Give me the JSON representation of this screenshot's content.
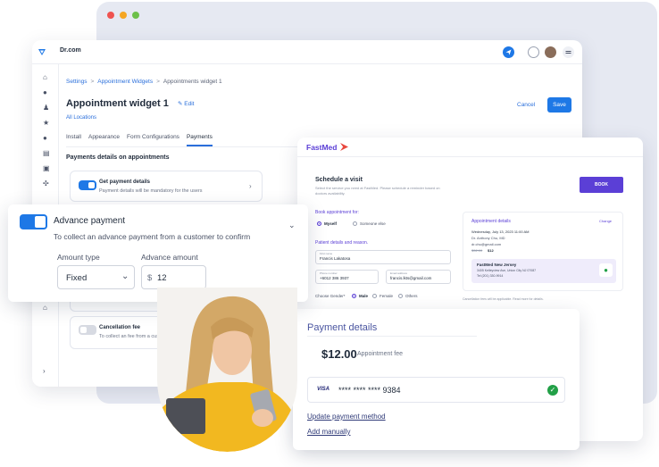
{
  "app": {
    "brand": "Dr.com",
    "breadcrumb": [
      "Settings",
      "Appointment Widgets",
      "Appointments widget 1"
    ],
    "page_title": "Appointment widget 1",
    "edit_label": "Edit",
    "locations_label": "All Locations",
    "cancel_label": "Cancel",
    "save_label": "Save",
    "tabs": [
      {
        "label": "Install"
      },
      {
        "label": "Appearance"
      },
      {
        "label": "Form Configurations"
      },
      {
        "label": "Payments"
      }
    ],
    "section_title": "Payments details on appointments",
    "get_payment": {
      "title": "Get payment details",
      "subtitle": "Payment details will be mandatory for the users"
    },
    "cancellation": {
      "title": "Cancellation fee",
      "subtitle": "To collect an fee from a custome"
    }
  },
  "advance_payment": {
    "title": "Advance payment",
    "subtitle": "To collect an advance payment from a customer to confirm",
    "amount_type_label": "Amount type",
    "amount_type_value": "Fixed",
    "advance_amount_label": "Advance amount",
    "currency_symbol": "$",
    "advance_amount_value": "12"
  },
  "fastmed": {
    "brand": "FastMed",
    "schedule_title": "Schedule a visit",
    "schedule_desc_1": "Select the service you need at FastMed. Please schedule a reminder based on",
    "schedule_desc_2": "doctors availability.",
    "book_label": "BOOK",
    "book_for_label": "Book appointment for:",
    "book_for_options": [
      "Myself",
      "Someone else"
    ],
    "patient_label": "Patient details and reason.",
    "name_field_label": "First name",
    "name_field_value": "Francis Lakatosa",
    "phone_label": "Phone number",
    "phone_value": "+6012 386 3937",
    "email_label": "Email address",
    "email_value": "francis.lkts@gmail.com",
    "gender_label": "Choose Gender*",
    "gender_options": [
      "Male",
      "Female",
      "Others"
    ],
    "appt_title": "Appointment details",
    "change_label": "Change",
    "appt_datetime": "Wednesday, July 13, 2023 11:00 AM",
    "doctor": "Dr. Anthony Chu, MD",
    "doctor_email": "dr.chu@gmail.com",
    "old_price": "$32.00",
    "new_price": "$12",
    "location_name": "FastMed New Jersey",
    "location_addr": "3405 Kelleyview Ave, Union City NJ 07087",
    "location_phone": "Tel (201) 330-9914",
    "disclaimer": "Cancellation fees will be applicable. Read more for details."
  },
  "payment": {
    "title": "Payment details",
    "amount": "$12.00",
    "amount_label": "Appointment fee",
    "card_brand": "VISA",
    "card_number": "**** **** **** 9384",
    "update_label": "Update payment method",
    "manual_label": "Add manually"
  },
  "colors": {
    "primary": "#1e78e6",
    "fastmed_purple": "#5b3fd6",
    "success": "#22a047"
  }
}
